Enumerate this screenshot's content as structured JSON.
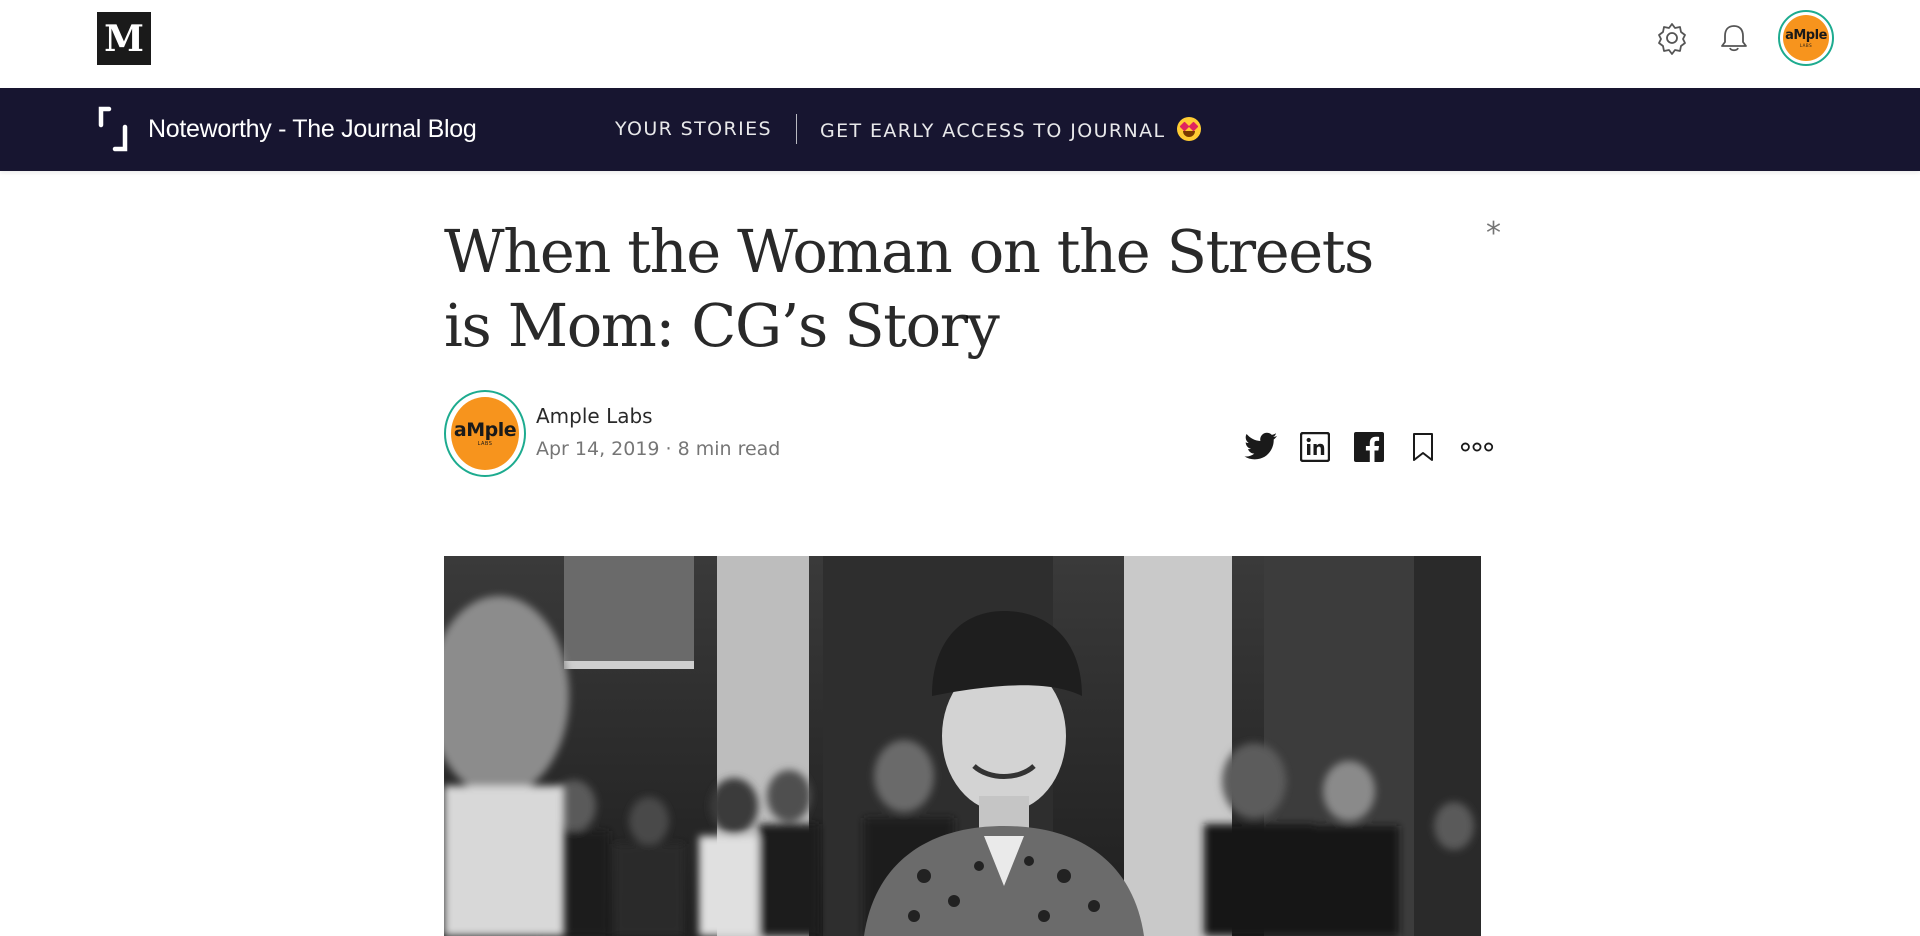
{
  "topbar": {
    "logo_letter": "M",
    "icons": [
      "settings-icon",
      "bell-icon"
    ],
    "user_avatar": {
      "brand": "aMple",
      "sub": "LABS"
    }
  },
  "publication": {
    "name": "Noteworthy - The Journal Blog",
    "nav": {
      "your_stories": "YOUR STORIES",
      "early_access": "GET EARLY ACCESS TO JOURNAL"
    },
    "emoji": "star-struck-emoji"
  },
  "article": {
    "title": "When the Woman on the Streets is Mom: CG’s Story",
    "star": "*",
    "author": {
      "name": "Ample Labs",
      "date": "Apr 14, 2019",
      "separator": "·",
      "read_time": "8 min read",
      "avatar": {
        "brand": "aMple",
        "sub": "LABS"
      }
    },
    "share_icons": [
      "twitter-icon",
      "linkedin-icon",
      "facebook-icon",
      "bookmark-icon",
      "more-icon"
    ]
  },
  "colors": {
    "nav_bg": "#171530",
    "avatar_orange": "#f7941d",
    "avatar_ring": "#1dab8f"
  }
}
